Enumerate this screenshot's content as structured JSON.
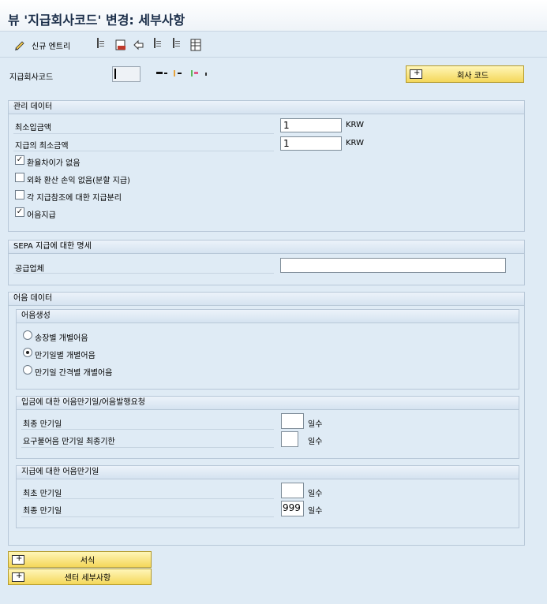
{
  "window": {
    "title": "뷰 '지급회사코드' 변경: 세부사항"
  },
  "toolbar": {
    "new_entries_label": "신규 엔트리"
  },
  "header": {
    "company_code_label": "지급회사코드",
    "company_code_value": "",
    "company_code_button": "회사 코드"
  },
  "admin": {
    "title": "관리 데이터",
    "min_receipt_label": "최소입금액",
    "min_receipt_value": "1",
    "min_receipt_currency": "KRW",
    "min_payment_label": "지급의 최소금액",
    "min_payment_value": "1",
    "min_payment_currency": "KRW",
    "no_fx_diff_label": "환율차이가 없음",
    "no_fx_diff_checked": true,
    "no_fx_loss_label": "외화 환산 손익 없음(분할 지급)",
    "no_fx_loss_checked": false,
    "separate_payment_label": "각 지급참조에 대한 지급분리",
    "separate_payment_checked": false,
    "bill_payment_label": "어음지급",
    "bill_payment_checked": true
  },
  "sepa": {
    "title": "SEPA 지급에 대한 명세",
    "supplier_label": "공급업체",
    "supplier_value": ""
  },
  "bills": {
    "title": "어음 데이터",
    "creation": {
      "title": "어음생성",
      "options": [
        {
          "label": "송장별 개별어음",
          "selected": false
        },
        {
          "label": "만기일별 개별어음",
          "selected": true
        },
        {
          "label": "만기일 간격별 개별어음",
          "selected": false
        }
      ]
    },
    "incoming": {
      "title": "입금에 대한 어음만기일/어음발행요청",
      "latest_due_label": "최종 만기일",
      "latest_due_value": "",
      "latest_due_unit": "일수",
      "demand_bill_label": "요구불어음 만기일 최종기한",
      "demand_bill_value": "",
      "demand_bill_unit": "일수"
    },
    "outgoing": {
      "title": "지급에 대한 어음만기일",
      "earliest_due_label": "최초 만기일",
      "earliest_due_value": "",
      "earliest_due_unit": "일수",
      "latest_due_label": "최종 만기일",
      "latest_due_value": "999",
      "latest_due_unit": "일수"
    }
  },
  "footer": {
    "forms_button": "서식",
    "center_details_button": "센터 세부사항"
  }
}
